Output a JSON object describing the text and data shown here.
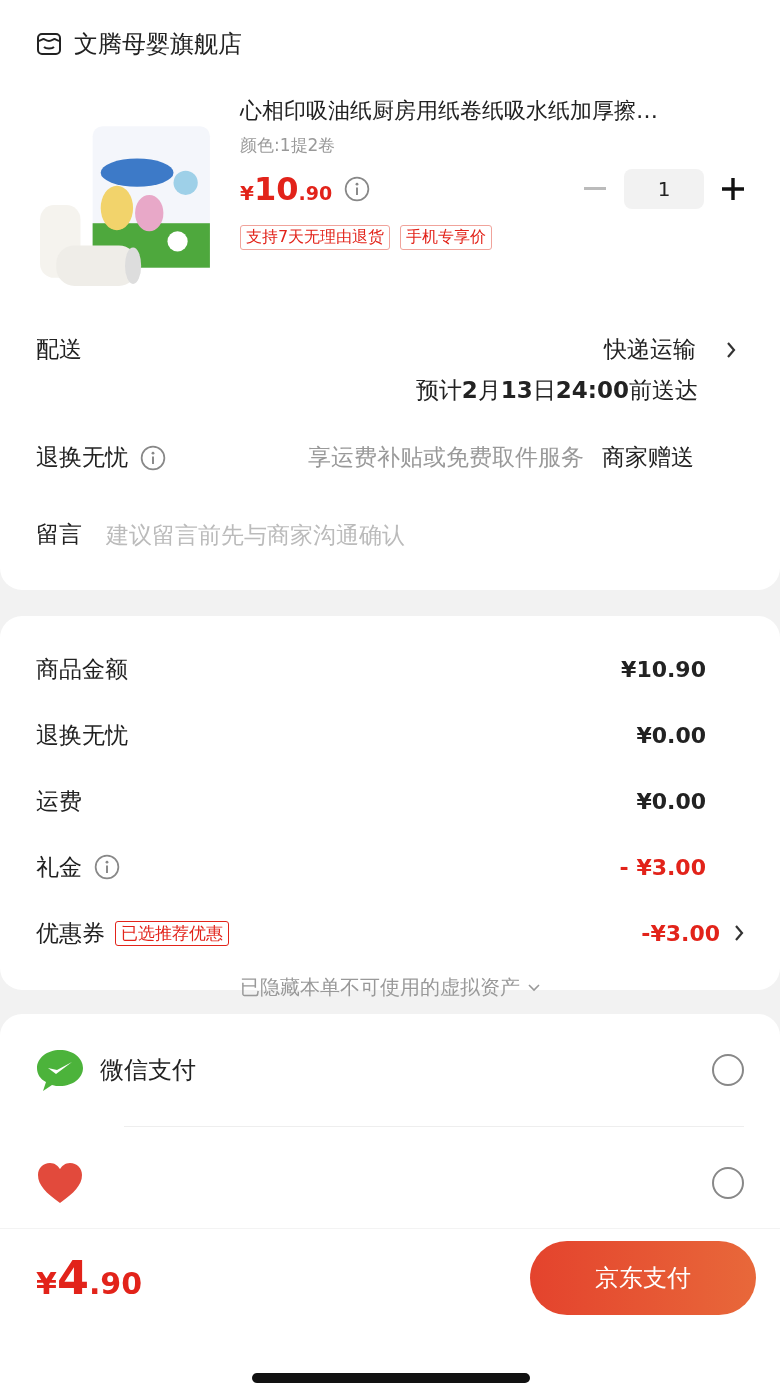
{
  "store": {
    "name": "文腾母婴旗舰店"
  },
  "product": {
    "title": "心相印吸油纸厨房用纸卷纸吸水纸加厚擦…",
    "spec": "颜色:1提2卷",
    "price": {
      "currency": "¥",
      "integer": "10",
      "decimal": ".90"
    },
    "quantity": "1",
    "tags": [
      "支持7天无理由退货",
      "手机专享价"
    ]
  },
  "delivery": {
    "label": "配送",
    "method": "快递运输",
    "estimate": "预计**2**月**13**日**24:00**前送达"
  },
  "return_service": {
    "label": "退换无忧",
    "description": "享运费补贴或免费取件服务",
    "provider": "商家赠送"
  },
  "message": {
    "label": "留言",
    "placeholder": "建议留言前先与商家沟通确认"
  },
  "summary": [
    {
      "label": "商品金额",
      "value": "¥10.90",
      "info": false,
      "negative": false,
      "chevron": false
    },
    {
      "label": "退换无忧",
      "value": "¥0.00",
      "info": false,
      "negative": false,
      "chevron": false
    },
    {
      "label": "运费",
      "value": "¥0.00",
      "info": false,
      "negative": false,
      "chevron": false
    },
    {
      "label": "礼金",
      "value": "- ¥3.00",
      "info": true,
      "negative": true,
      "chevron": false
    },
    {
      "label": "优惠券",
      "badge": "已选推荐优惠",
      "value": "-¥3.00",
      "info": false,
      "negative": true,
      "chevron": true
    }
  ],
  "hidden_note": "已隐藏本单不可使用的虚拟资产",
  "payment_methods": [
    {
      "kind": "wechat",
      "name": "微信支付",
      "selected": false
    },
    {
      "kind": "friend",
      "selected": false
    }
  ],
  "footer": {
    "total": {
      "currency": "¥",
      "integer": "4",
      "decimal": ".90"
    },
    "pay_button": "京东支付"
  }
}
